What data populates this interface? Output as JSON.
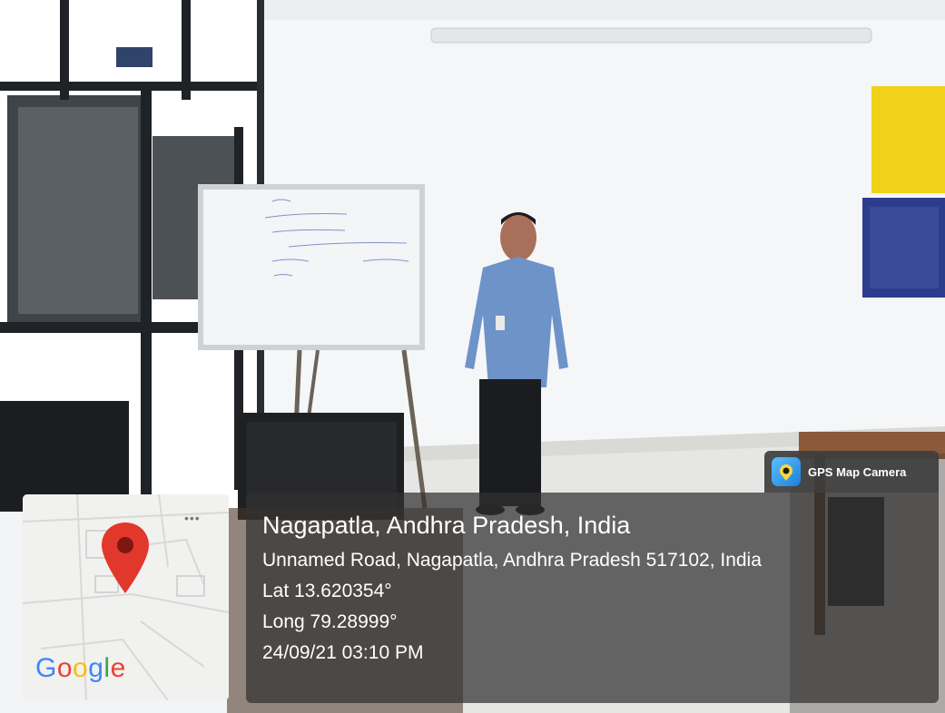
{
  "badge": {
    "app_name": "GPS Map Camera",
    "icon": "map-pin-camera-icon"
  },
  "location": {
    "place": "Nagapatla, Andhra Pradesh, India",
    "address": "Unnamed Road, Nagapatla, Andhra Pradesh 517102, India",
    "latitude": "Lat 13.620354°",
    "longitude": "Long 79.28999°",
    "datetime": "24/09/21 03:10 PM"
  },
  "map": {
    "provider_logo": "Google",
    "marker": "location-pin-icon",
    "pin_color": "#d93025",
    "logo_colors": [
      "#4285F4",
      "#EA4335",
      "#FBBC05",
      "#4285F4",
      "#34A853",
      "#EA4335"
    ]
  },
  "scene": {
    "subject": "man in blue shirt standing in front of whiteboard",
    "wall_color": "#f4f5f7",
    "shirt_color": "#6e93c9"
  }
}
